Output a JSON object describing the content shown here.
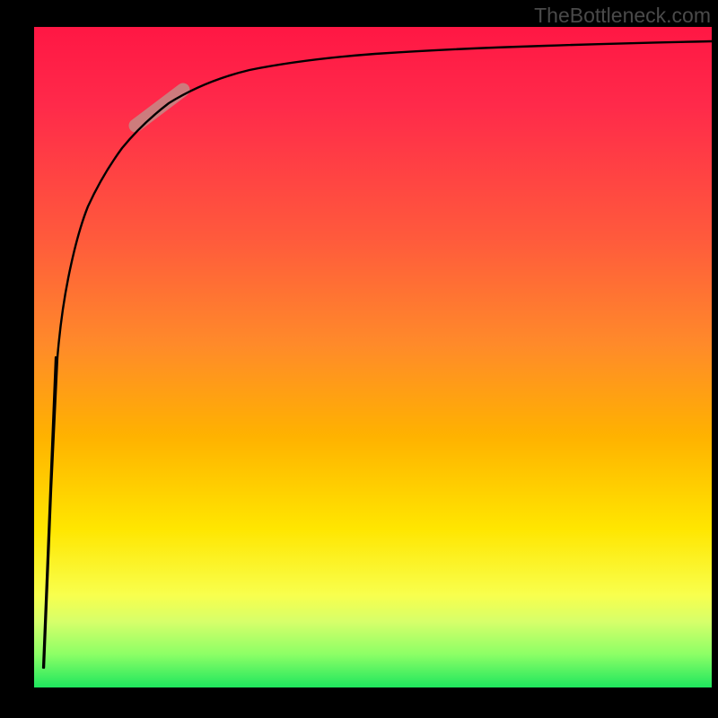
{
  "watermark": {
    "text": "TheBottleneck.com"
  },
  "chart_data": {
    "type": "line",
    "title": "",
    "xlabel": "",
    "ylabel": "",
    "xlim": [
      0,
      100
    ],
    "ylim": [
      0,
      100
    ],
    "grid": false,
    "legend": null,
    "background_gradient": {
      "direction": "vertical",
      "stops": [
        {
          "pos": 0,
          "color": "#ff1744"
        },
        {
          "pos": 50,
          "color": "#ff9a1a"
        },
        {
          "pos": 78,
          "color": "#ffe600"
        },
        {
          "pos": 95,
          "color": "#8cff66"
        },
        {
          "pos": 100,
          "color": "#1ee65e"
        }
      ]
    },
    "series": [
      {
        "name": "bottleneck-curve",
        "x": [
          1.5,
          2.5,
          3.5,
          5,
          7,
          10,
          14,
          18,
          24,
          32,
          40,
          50,
          60,
          70,
          80,
          90,
          100
        ],
        "y": [
          3,
          30,
          50,
          62,
          72,
          80,
          85,
          88,
          90.5,
          92.5,
          93.5,
          94.5,
          95.2,
          95.8,
          96.2,
          96.5,
          96.8
        ]
      }
    ],
    "highlight_segment": {
      "series": "bottleneck-curve",
      "x_range": [
        15,
        22
      ],
      "color": "#c48a86",
      "width": 12
    },
    "vertical_guide": {
      "x": 3.5,
      "y_range": [
        3,
        50
      ],
      "color": "#000",
      "width": 2
    }
  }
}
